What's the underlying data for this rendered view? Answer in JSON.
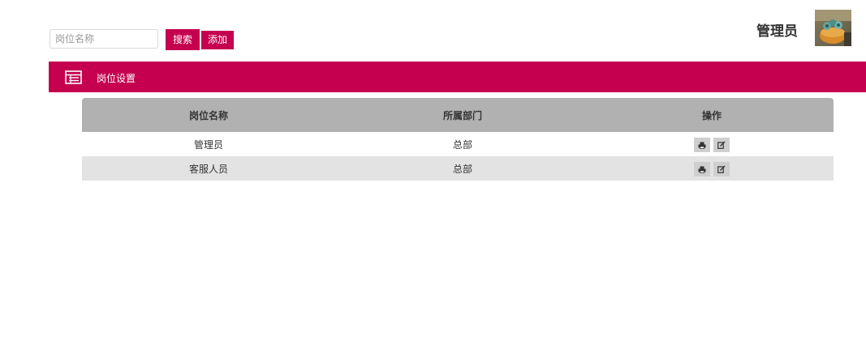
{
  "toolbar": {
    "search_placeholder": "岗位名称",
    "search_value": "",
    "search_button": "搜索",
    "add_button": "添加"
  },
  "user": {
    "name": "管理员",
    "avatar_icon": "avatar-photo-icon"
  },
  "title_bar": {
    "icon": "list-table-icon",
    "label": "岗位设置",
    "color": "#c4004f"
  },
  "table": {
    "columns": [
      "岗位名称",
      "所属部门",
      "操作"
    ],
    "rows": [
      {
        "name": "管理员",
        "department": "总部"
      },
      {
        "name": "客服人员",
        "department": "总部"
      }
    ],
    "actions": [
      "printer-icon",
      "edit-icon"
    ]
  },
  "colors": {
    "accent": "#c4004f",
    "header_bg": "#b1b1b1",
    "row_alt_bg": "#e3e3e3"
  }
}
